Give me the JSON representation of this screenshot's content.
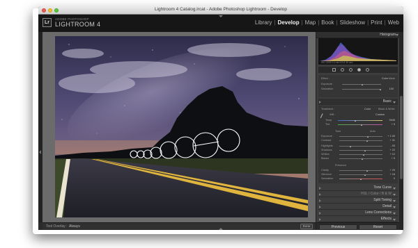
{
  "window": {
    "title": "Lightroom 4 Catalog.lrcat - Adobe Photoshop Lightroom - Develop"
  },
  "brand": {
    "sub": "ADOBE PHOTOSHOP",
    "name": "LIGHTROOM 4",
    "logo": "Lr"
  },
  "modules": [
    "Library",
    "Develop",
    "Map",
    "Book",
    "Slideshow",
    "Print",
    "Web"
  ],
  "active_module": "Develop",
  "panel": {
    "histogram_label": "Histogram",
    "histogram_info": "ISO 3200     14 mm     f/2.8     30 sec",
    "basic_label": "Basic",
    "treatment_label": "Treatment :",
    "treatment_color": "Color",
    "treatment_bw": "Black & White",
    "wb_label": "WB :",
    "wb_value": "Custom",
    "temp_label": "Temp",
    "temp_value": "3945",
    "tint_label": "Tint",
    "tint_value": "+ 5",
    "tone_label": "Tone",
    "tone_auto": "Auto",
    "exposure_label": "Exposure",
    "exposure_value": "+ 1.00",
    "contrast_label": "Contrast",
    "contrast_value": "+ 31",
    "highlights_label": "Highlights",
    "highlights_value": "- 53",
    "shadows_label": "Shadows",
    "shadows_value": "+ 22",
    "whites_label": "Whites",
    "whites_value": "+ 12",
    "blacks_label": "Blacks",
    "blacks_value": "+ 5",
    "presence_label": "Presence",
    "clarity_label": "Clarity",
    "clarity_value": "+ 29",
    "vibrance_label": "Vibrance",
    "vibrance_value": "+ 18",
    "saturation_label": "Saturation",
    "saturation_value": "0",
    "mask_color": "Color",
    "mask_value": "100",
    "sections": [
      "Tone Curve",
      "HSL / Color / B & W",
      "Split Toning",
      "Detail",
      "Lens Corrections",
      "Effects"
    ],
    "previous_btn": "Previous",
    "reset_btn": "Reset"
  },
  "toolbar": {
    "label": "Tool Overlay :",
    "value": "Always",
    "done": "Done"
  }
}
